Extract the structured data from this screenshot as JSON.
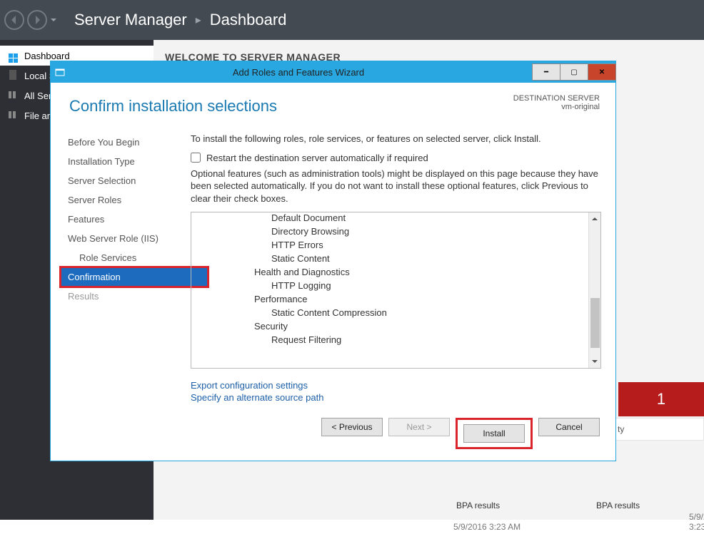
{
  "header": {
    "app": "Server Manager",
    "breadcrumb": "Dashboard"
  },
  "leftnav": {
    "dashboard": "Dashboard",
    "local": "Local Server",
    "all": "All Servers",
    "file": "File and Storage Services"
  },
  "welcome": "WELCOME TO SERVER MANAGER",
  "behind": {
    "redCount": "1",
    "rightLabel": "ty",
    "ts": "5/9/2016 3:23 AM",
    "bpa": "BPA results"
  },
  "dialog": {
    "title": "Add Roles and Features Wizard",
    "heading": "Confirm installation selections",
    "destLabel": "DESTINATION SERVER",
    "destServer": "vm-original",
    "intro": "To install the following roles, role services, or features on selected server, click Install.",
    "restart": "Restart the destination server automatically if required",
    "optional": "Optional features (such as administration tools) might be displayed on this page because they have been selected automatically. If you do not want to install these optional features, click Previous to clear their check boxes.",
    "steps": {
      "begin": "Before You Begin",
      "type": "Installation Type",
      "selection": "Server Selection",
      "roles": "Server Roles",
      "features": "Features",
      "webrole": "Web Server Role (IIS)",
      "roleservices": "Role Services",
      "confirmation": "Confirmation",
      "results": "Results"
    },
    "roleList": {
      "defaultDoc": "Default Document",
      "dirBrowse": "Directory Browsing",
      "httpErrors": "HTTP Errors",
      "staticContent": "Static Content",
      "health": "Health and Diagnostics",
      "httpLog": "HTTP Logging",
      "perf": "Performance",
      "compress": "Static Content Compression",
      "security": "Security",
      "reqFilter": "Request Filtering"
    },
    "links": {
      "export": "Export configuration settings",
      "altPath": "Specify an alternate source path"
    },
    "buttons": {
      "prev": "< Previous",
      "next": "Next >",
      "install": "Install",
      "cancel": "Cancel"
    }
  }
}
